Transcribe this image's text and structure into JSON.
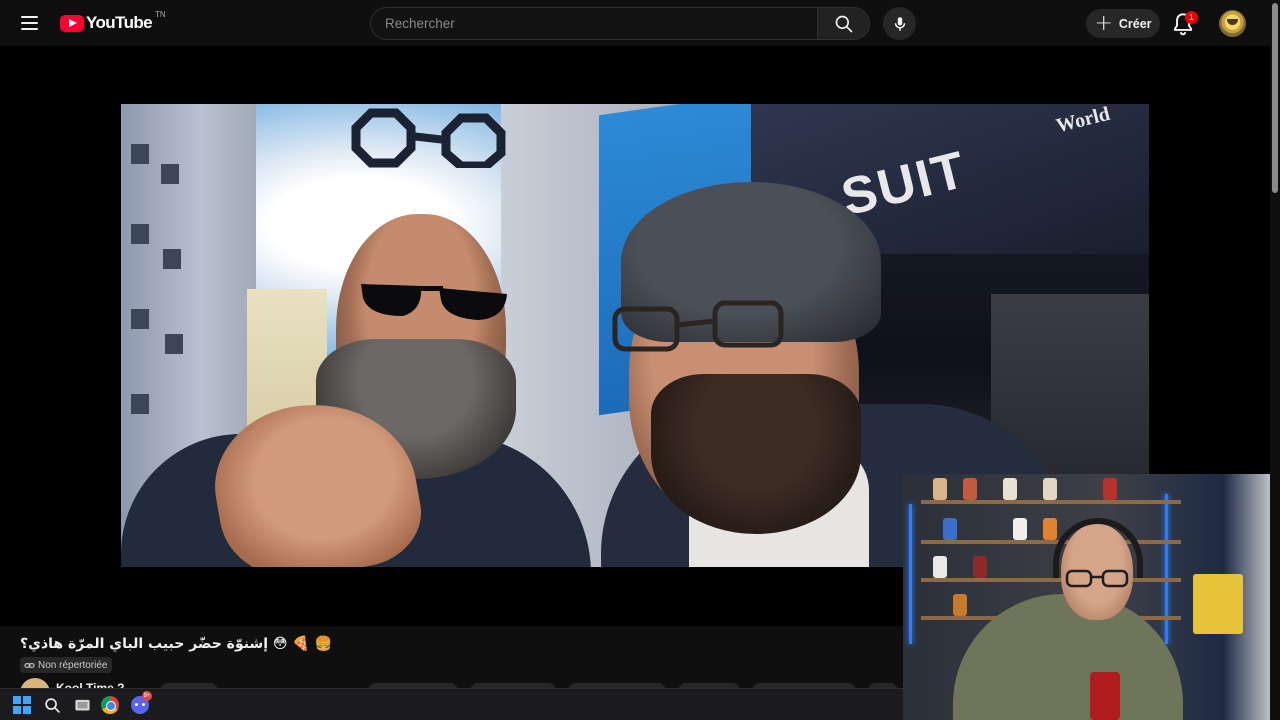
{
  "header": {
    "logo_text": "YouTube",
    "logo_region": "TN",
    "search_placeholder": "Rechercher",
    "create_label": "Créer",
    "notification_count": "1"
  },
  "video": {
    "title": "🍔 🍕 😳 إشنوّة حضّر حبيب الباي المرّة هاذي؟",
    "visibility": "Non répertoriée",
    "channel_name": "Kool Time ?",
    "store_sign_text": "SUIT",
    "store_sign_text2": "World"
  },
  "taskbar": {
    "discord_badge": "9+"
  },
  "colors": {
    "background": "#0f0f0f",
    "brand_red": "#ff0033",
    "accent_blue": "#3ea6ff",
    "badge_red": "#e00000"
  },
  "icons": [
    "menu-icon",
    "youtube-logo-icon",
    "search-icon",
    "mic-icon",
    "plus-icon",
    "bell-icon",
    "link-icon",
    "windows-start-icon",
    "taskbar-search-icon",
    "file-explorer-icon",
    "chrome-icon",
    "discord-icon"
  ]
}
